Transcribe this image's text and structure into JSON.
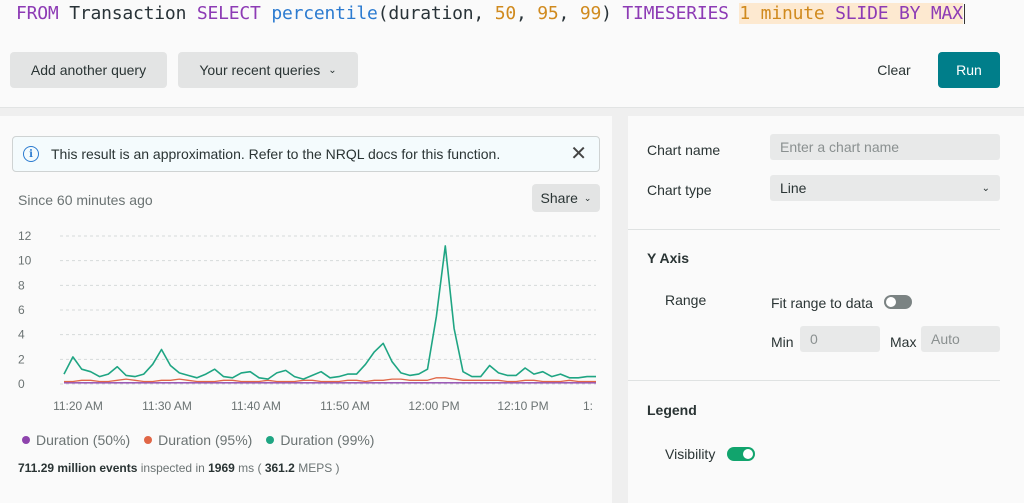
{
  "query": {
    "tokens": {
      "t0": "FROM",
      "t1": " Transaction ",
      "t2": "SELECT",
      "t3": " ",
      "t4": "percentile",
      "t5": "(duration, ",
      "t6": "50",
      "t7": ", ",
      "t8": "95",
      "t9": ", ",
      "t10": "99",
      "t11": ") ",
      "t12": "TIMESERIES",
      "t13": " ",
      "t14": "1 minute",
      "t15": " SLIDE BY MAX"
    }
  },
  "toolbar": {
    "add_query": "Add another query",
    "recent_queries": "Your recent queries",
    "clear": "Clear",
    "run": "Run"
  },
  "notice": {
    "text": "This result is an approximation. Refer to the NRQL docs for this function."
  },
  "chart_header": {
    "since": "Since 60 minutes ago",
    "share": "Share"
  },
  "chart_data": {
    "type": "line",
    "ylim": [
      0,
      12
    ],
    "yticks": [
      "0",
      "2",
      "4",
      "6",
      "8",
      "10",
      "12"
    ],
    "xticks": [
      "11:20 AM",
      "11:30 AM",
      "11:40 AM",
      "11:50 AM",
      "12:00 PM",
      "12:10 PM",
      "1:"
    ],
    "colors": {
      "p50": "#8e44ad",
      "p95": "#e06646",
      "p99": "#1fa583"
    },
    "series": [
      {
        "name": "Duration (50%)",
        "values": [
          0.1,
          0.1,
          0.1,
          0.1,
          0.1,
          0.1,
          0.1,
          0.1,
          0.1,
          0.1,
          0.1,
          0.1,
          0.1,
          0.1,
          0.1,
          0.1,
          0.1,
          0.1,
          0.1,
          0.1,
          0.1,
          0.1,
          0.1,
          0.1,
          0.1,
          0.1,
          0.1,
          0.1,
          0.1,
          0.1,
          0.1,
          0.1,
          0.1,
          0.1,
          0.1,
          0.1,
          0.1,
          0.1,
          0.1,
          0.1,
          0.1,
          0.1,
          0.1,
          0.1,
          0.1,
          0.1,
          0.1,
          0.1,
          0.1,
          0.1,
          0.1,
          0.1,
          0.1,
          0.1,
          0.1,
          0.1,
          0.1,
          0.1,
          0.1,
          0.1,
          0.1
        ]
      },
      {
        "name": "Duration (95%)",
        "values": [
          0.2,
          0.2,
          0.3,
          0.3,
          0.2,
          0.2,
          0.3,
          0.4,
          0.3,
          0.2,
          0.2,
          0.3,
          0.3,
          0.4,
          0.3,
          0.2,
          0.2,
          0.2,
          0.3,
          0.3,
          0.2,
          0.2,
          0.2,
          0.3,
          0.2,
          0.2,
          0.2,
          0.3,
          0.3,
          0.2,
          0.2,
          0.2,
          0.3,
          0.3,
          0.2,
          0.3,
          0.3,
          0.4,
          0.4,
          0.3,
          0.3,
          0.3,
          0.5,
          0.5,
          0.4,
          0.3,
          0.3,
          0.3,
          0.3,
          0.3,
          0.2,
          0.2,
          0.3,
          0.3,
          0.2,
          0.2,
          0.2,
          0.3,
          0.2,
          0.2,
          0.2
        ]
      },
      {
        "name": "Duration (99%)",
        "values": [
          0.8,
          2.2,
          1.2,
          1.0,
          0.6,
          0.8,
          1.4,
          0.7,
          0.6,
          0.8,
          1.6,
          2.8,
          1.5,
          0.9,
          0.7,
          0.5,
          0.8,
          1.2,
          0.6,
          0.5,
          0.9,
          1.0,
          0.5,
          0.4,
          0.9,
          1.1,
          0.6,
          0.4,
          0.7,
          1.0,
          0.5,
          0.6,
          0.8,
          0.8,
          1.6,
          2.6,
          3.3,
          1.8,
          0.9,
          0.7,
          0.8,
          1.2,
          5.5,
          11.2,
          4.5,
          1.0,
          0.6,
          0.6,
          1.5,
          0.9,
          0.7,
          0.7,
          1.3,
          0.8,
          1.0,
          0.6,
          0.8,
          0.5,
          0.5,
          0.6,
          0.6
        ]
      }
    ]
  },
  "legend": {
    "items": [
      "Duration (50%)",
      "Duration (95%)",
      "Duration (99%)"
    ]
  },
  "events": {
    "count": "711.29 million events",
    "inspected": " inspected in ",
    "ms": "1969",
    "ms_unit": " ms ( ",
    "meps": "361.2",
    "meps_unit": " MEPS",
    "close": " )"
  },
  "settings": {
    "chart_name_label": "Chart name",
    "chart_name_placeholder": "Enter a chart name",
    "chart_type_label": "Chart type",
    "chart_type_value": "Line",
    "y_axis_title": "Y Axis",
    "range_label": "Range",
    "fit_range_label": "Fit range to data",
    "fit_range_on": false,
    "min_label": "Min",
    "min_placeholder": "0",
    "max_label": "Max",
    "max_placeholder": "Auto",
    "legend_title": "Legend",
    "visibility_label": "Visibility",
    "visibility_on": true
  }
}
